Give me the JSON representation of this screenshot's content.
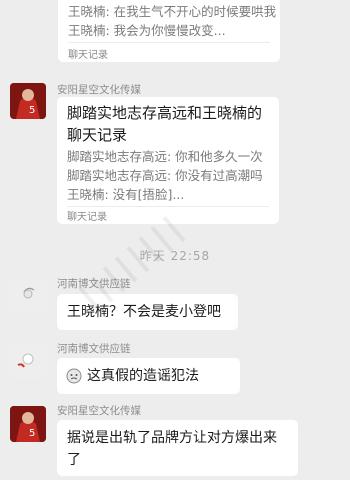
{
  "top_card": {
    "lines": [
      "王晓楠: 在我生气不开心的时候要哄我",
      "王晓楠: 我会为你慢慢改变..."
    ],
    "footer": "聊天记录"
  },
  "msg1": {
    "sender": "安阳星空文化传媒",
    "title": "脚踏实地志存高远和王晓楠的聊天记录",
    "lines": [
      "脚踏实地志存高远: 你和他多久一次",
      "脚踏实地志存高远: 你没有过高潮吗",
      "王晓楠: 没有[捂脸]..."
    ],
    "footer": "聊天记录"
  },
  "timestamp": "昨天 22:58",
  "msg2": {
    "sender": "河南博文供应链",
    "text": "王晓楠？不会是麦小登吧"
  },
  "msg3": {
    "sender": "河南博文供应链",
    "text": "这真假的造谣犯法"
  },
  "msg4": {
    "sender": "安阳星空文化传媒",
    "text": "据说是出轨了品牌方让对方爆出来了"
  },
  "colors": {
    "background": "#ededed",
    "bubble": "#ffffff",
    "meta_text": "#8c8c8c"
  }
}
